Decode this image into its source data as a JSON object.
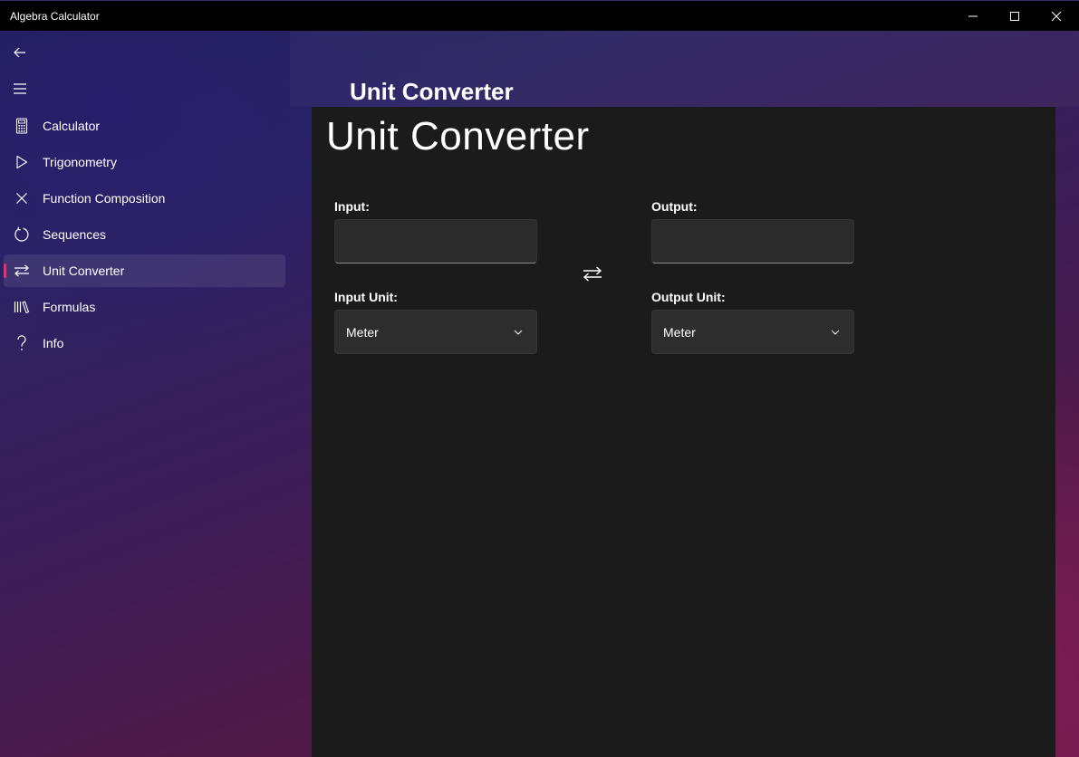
{
  "window": {
    "title": "Algebra Calculator",
    "controls": [
      "minimize-icon",
      "maximize-icon",
      "close-icon"
    ]
  },
  "nav": {
    "back_icon": "back-arrow-icon",
    "menu_icon": "hamburger-menu-icon",
    "selected_index": 4,
    "accent_color": "#e9306a",
    "items": [
      {
        "label": "Calculator",
        "icon": "calculator-icon"
      },
      {
        "label": "Trigonometry",
        "icon": "triangle-play-icon"
      },
      {
        "label": "Function Composition",
        "icon": "x-cross-icon"
      },
      {
        "label": "Sequences",
        "icon": "refresh-circle-icon"
      },
      {
        "label": "Unit Converter",
        "icon": "swap-arrows-icon"
      },
      {
        "label": "Formulas",
        "icon": "library-books-icon"
      },
      {
        "label": "Info",
        "icon": "question-mark-icon"
      }
    ]
  },
  "header": {
    "title": "Unit Converter"
  },
  "converter": {
    "page_title": "Unit Converter",
    "input_label": "Input:",
    "input_value": "",
    "output_label": "Output:",
    "output_value": "",
    "input_unit_label": "Input Unit:",
    "input_unit_value": "Meter",
    "output_unit_label": "Output Unit:",
    "output_unit_value": "Meter",
    "swap_icon": "swap-arrows-icon"
  }
}
